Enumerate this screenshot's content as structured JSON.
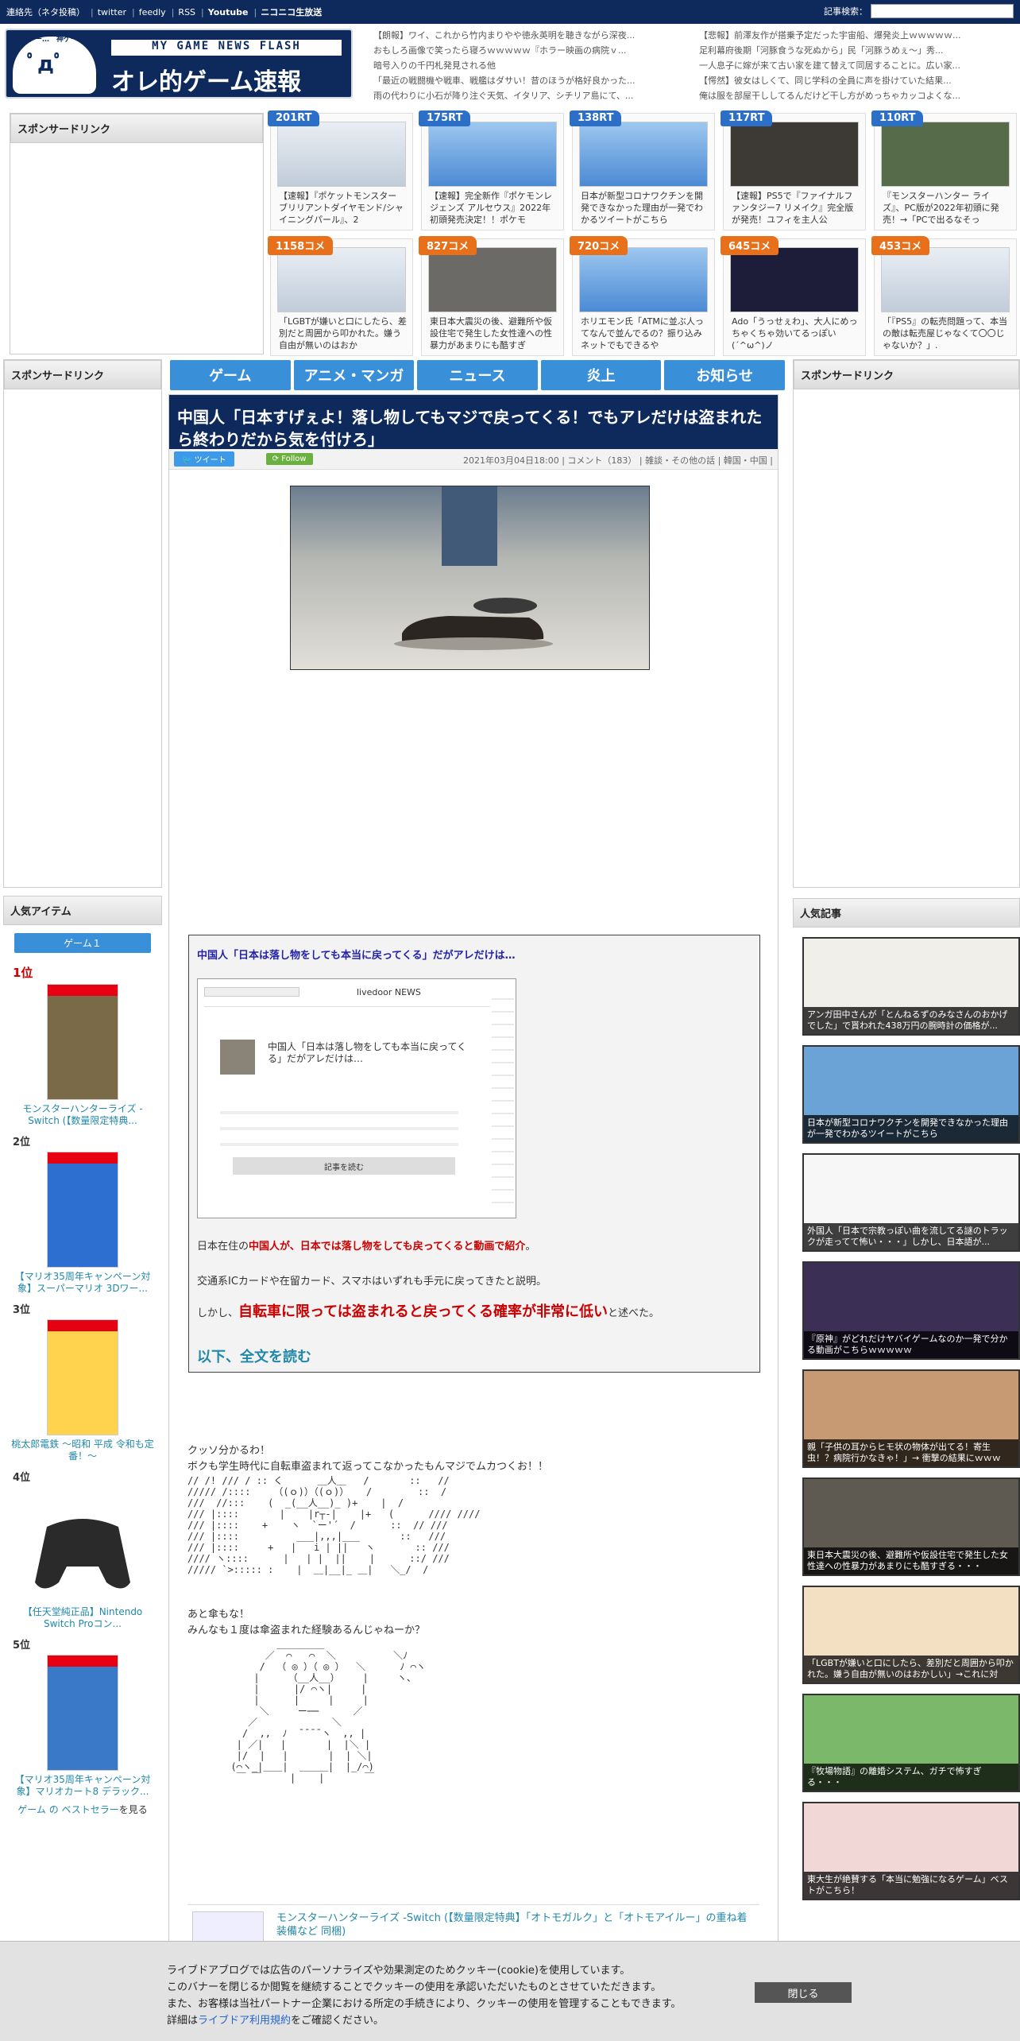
{
  "topbar": {
    "links": [
      "連絡先（ネタ投稿）",
      "twitter",
      "feedly",
      "RSS",
      "Youtube",
      "ニコニコ生放送"
    ],
    "search_label": "記事検索："
  },
  "logo": {
    "mini": "神ゲー…　神ゲー…",
    "sub": "MY GAME NEWS FLASH",
    "title": "オレ的ゲーム速報@JIN"
  },
  "head_news": [
    "【朗報】ワイ、これから竹内まりやや徳永英明を聴きながら深夜...",
    "【悲報】前澤友作が搭乗予定だった宇宙船、爆発炎上ｗｗｗｗｗ...",
    "おもしろ画像で笑ったら寝ろｗｗｗｗｗ『ホラー映画の病院ｖ...",
    "足利幕府後期「河豚食うな死ぬから」民「河豚うめぇ～」秀...",
    "暗号入りの千円札発見される他",
    "一人息子に嫁が来て古い家を建て替えて同居することに。広い家...",
    "「最近の戦闘機や戦車、戦艦はダサい！昔のほうが格好良かった...",
    "【愕然】彼女はしくて、同じ学科の全員に声を掛けていた結果...",
    "雨の代わりに小石が降り注ぐ天気、イタリア、シチリア島にて、...",
    "俺は服を部屋干ししてるんだけど干し方がめっちゃカッコよくな..."
  ],
  "sponsor_label": "スポンサードリンク",
  "cards": [
    {
      "badge": "201RT",
      "kind": "rt",
      "text": "【速報】『ポケットモンスター ブリリアントダイヤモンド/シャイニングパール』、2"
    },
    {
      "badge": "175RT",
      "kind": "rt",
      "text": "【速報】完全新作『ポケモンレジェンズ アルセウス』2022年初頭発売決定！！ポケモ"
    },
    {
      "badge": "138RT",
      "kind": "rt",
      "text": "日本が新型コロナワクチンを開発できなかった理由が一発でわかるツイートがこちら"
    },
    {
      "badge": "117RT",
      "kind": "rt",
      "text": "【速報】PS5で『ファイナルファンタジー7 リメイク』完全版が発売！ユフィを主人公"
    },
    {
      "badge": "110RT",
      "kind": "rt",
      "text": "『モンスターハンター ライズ』、PC版が2022年初頭に発売！→「PCで出るなそっ"
    },
    {
      "badge": "1158コメ",
      "kind": "com",
      "text": "「LGBTが嫌いと口にしたら、差別だと周囲から叩かれた。嫌う自由が無いのはおか"
    },
    {
      "badge": "827コメ",
      "kind": "com",
      "text": "東日本大震災の後、避難所や仮設住宅で発生した女性達への性暴力があまりにも酷すぎ"
    },
    {
      "badge": "720コメ",
      "kind": "com",
      "text": "ホリエモン氏「ATMに並ぶ人ってなんで並んでるの？振り込みネットでもできるや"
    },
    {
      "badge": "645コメ",
      "kind": "com",
      "text": "Ado「うっせぇわ」、大人にめっちゃくちゃ効いてるっぽい(´^ω^)ノ"
    },
    {
      "badge": "453コメ",
      "kind": "com",
      "text": "「『PS5』の転売問題って、本当の敵は転売屋じゃなくて〇〇じゃないか？」."
    }
  ],
  "nav": [
    "ゲーム",
    "アニメ・マンガ",
    "ニュース",
    "炎上",
    "お知らせ"
  ],
  "article": {
    "title": "中国人「日本すげぇよ！落し物してもマジで戻ってくる！でもアレだけは盗まれたら終わりだから気を付けろ」",
    "tweet": "ツイート",
    "follow": "Follow",
    "meta": "2021年03月04日18:00 | コメント（183） | 雑談・その他の話 | 韓国・中国 |"
  },
  "quote": {
    "title": "中国人「日本は落し物をしても本当に戻ってくる」だがアレだけは…",
    "shot_title": "中国人「日本は落し物をしても本当に戻ってくる」だがアレだけは…",
    "shot_site": "livedoor NEWS",
    "shot_button": "記事を読む",
    "l1a": "日本在住の",
    "l1b": "中国人が、日本では落し物をしても戻ってくると動画で紹介",
    "l1c": "。",
    "l2": "交通系ICカードや在留カード、スマホはいずれも手元に戻ってきたと説明。",
    "l3a": "しかし、",
    "l3b": "自転車に限っては盗まれると戻ってくる確率が非常に低い",
    "l3c": "と述べた。",
    "more": "以下、全文を読む"
  },
  "body": {
    "p1": "クッソ分かるわ！",
    "p2": "ボクも学生時代に自転車盗まれて返ってこなかったもんマジでムカつくお！！",
    "p3": "あと傘もな！",
    "p4": "みんなも１度は傘盗まれた経験あるんじゃねーか？"
  },
  "ranking": {
    "header": "人気アイテム",
    "tab": "ゲーム１",
    "items": [
      {
        "pos": "1位",
        "name": "モンスターハンターライズ -Switch (【数量限定特典..."
      },
      {
        "pos": "2位",
        "name": "【マリオ35周年キャンペーン対象】スーパーマリオ 3Dワー..."
      },
      {
        "pos": "3位",
        "name": "桃太郎電鉄 ～昭和 平成 令和も定番！～"
      },
      {
        "pos": "4位",
        "name": "【任天堂純正品】Nintendo Switch Proコン..."
      },
      {
        "pos": "5位",
        "name": "【マリオ35周年キャンペーン対象】マリオカート8 デラック..."
      }
    ],
    "footer_a": "ゲーム の ベストセラー",
    "footer_b": "を見る"
  },
  "popular": {
    "header": "人気記事",
    "items": [
      "アンガ田中さんが「とんねるずのみなさんのおかげでした」で貰われた438万円の腕時計の価格が...",
      "日本が新型コロナワクチンを開発できなかった理由が一発でわかるツイートがこちら",
      "外国人「日本で宗教っぽい曲を流してる謎のトラックが走ってて怖い・・・」しかし、日本語が...",
      "『原神』がどれだけヤバイゲームなのか一発で分かる動画がこちらｗｗｗｗｗ",
      "親「子供の耳からヒモ状の物体が出てる！寄生虫！？病院行かなきゃ！」→ 衝撃の結果にｗｗｗ",
      "東日本大震災の後、避難所や仮設住宅で発生した女性達への性暴力があまりにも酷すぎる・・・",
      "「LGBTが嫌いと口にしたら、差別だと周囲から叩かれた。嫌う自由が無いのはおかしい」→これに対",
      "『牧場物語』の離婚システム、ガチで怖すぎる・・・",
      "東大生が絶賛する「本当に勉強になるゲーム」ベストがこちら！"
    ]
  },
  "amazon_link": "モンスターハンターライズ -Switch (【数量限定特典】「オトモガルク」と「オトモアイルー」の重ね着装備など 同梱)",
  "cookie": {
    "l1": "ライブドアブログでは広告のパーソナライズや効果測定のためクッキー(cookie)を使用しています。",
    "l2": "このバナーを閉じるか閲覧を継続することでクッキーの使用を承認いただいたものとさせていただきます。",
    "l3": "また、お客様は当社パートナー企業における所定の手続きにより、クッキーの使用を管理することもできます。",
    "l4a": "詳細は",
    "l4b": "ライブドア利用規約",
    "l4c": "をご確認ください。",
    "close": "閉じる"
  }
}
